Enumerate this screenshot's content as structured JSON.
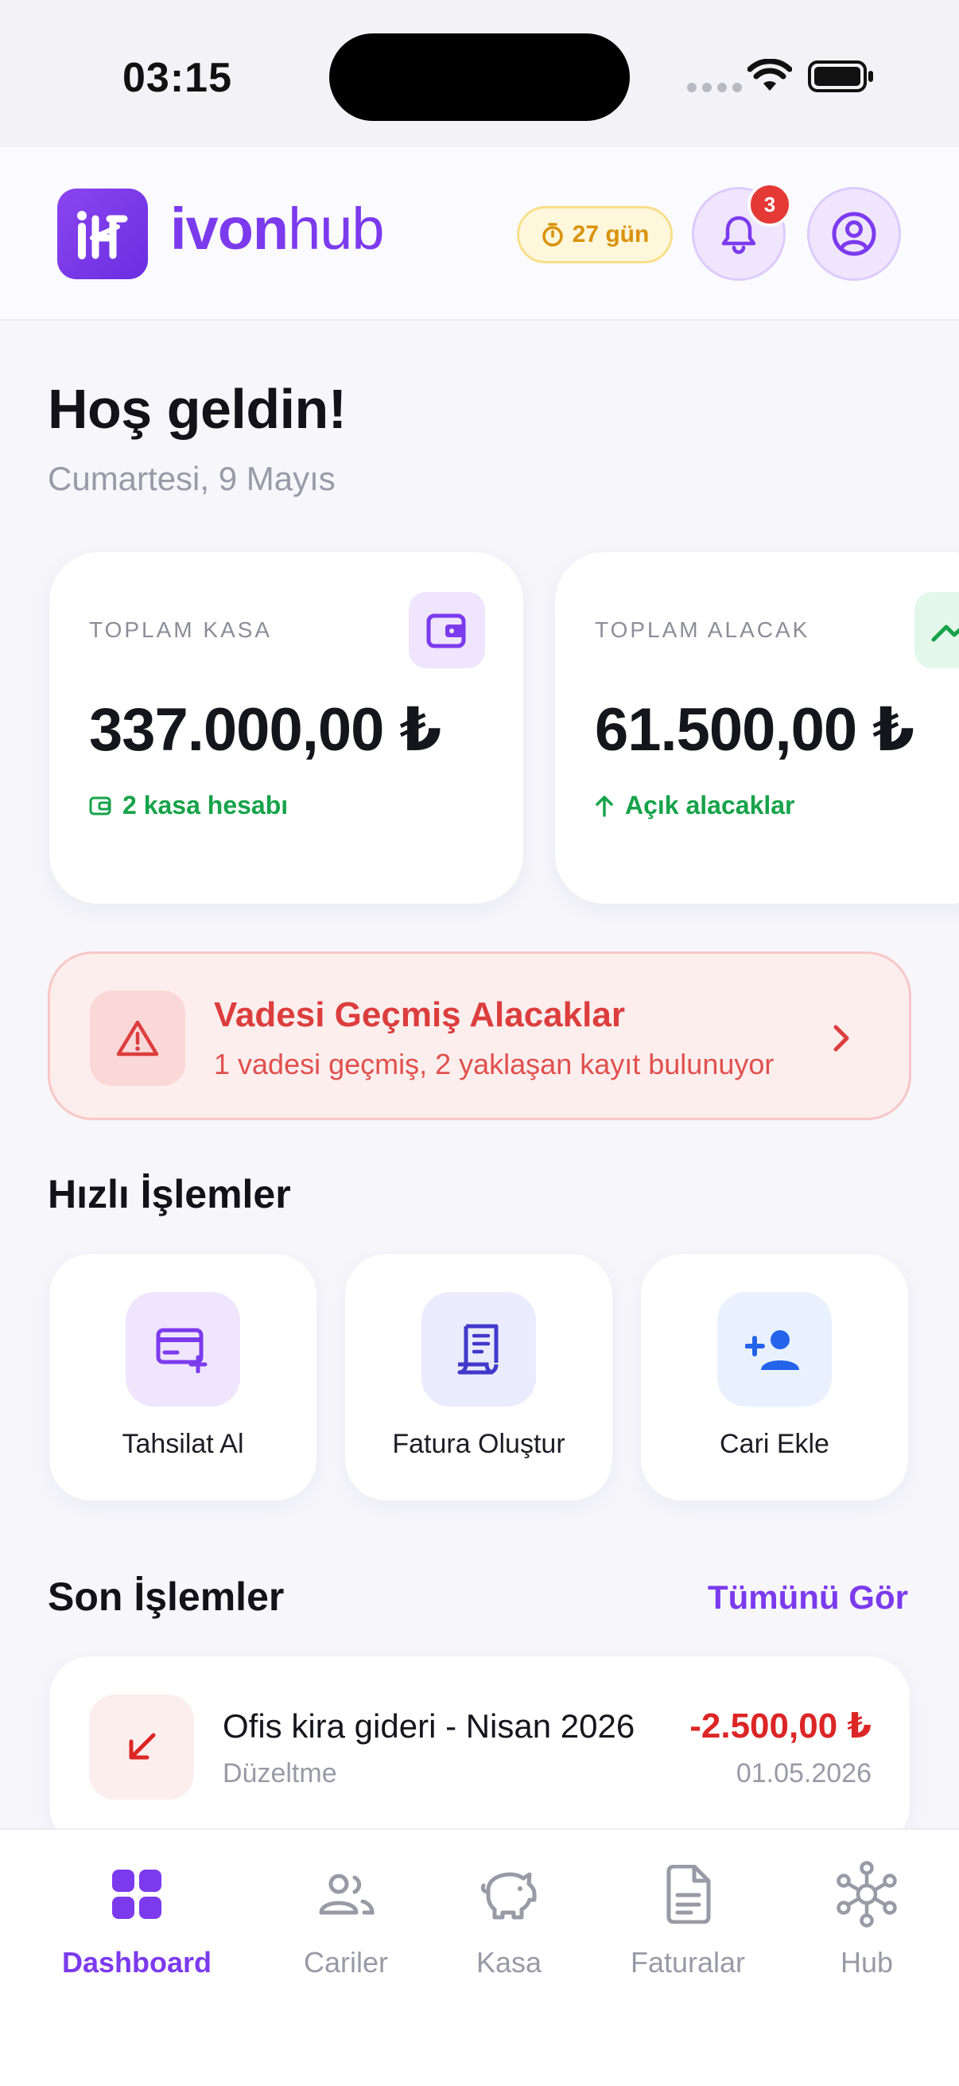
{
  "status_bar": {
    "time": "03:15"
  },
  "header": {
    "brand_bold": "ivon",
    "brand_light": "hub",
    "trial_label": "27 gün",
    "notification_count": "3"
  },
  "greeting": {
    "title": "Hoş geldin!",
    "date": "Cumartesi, 9 Mayıs"
  },
  "stats": [
    {
      "label": "TOPLAM KASA",
      "value": "337.000,00 ₺",
      "sub": "2 kasa hesabı",
      "icon": "wallet-icon"
    },
    {
      "label": "TOPLAM ALACAK",
      "value": "61.500,00 ₺",
      "sub": "Açık alacaklar",
      "icon": "trend-up-icon"
    }
  ],
  "alert": {
    "title": "Vadesi Geçmiş Alacaklar",
    "description": "1 vadesi geçmiş, 2 yaklaşan kayıt bulunuyor"
  },
  "quick_actions": {
    "title": "Hızlı İşlemler",
    "items": [
      {
        "label": "Tahsilat Al",
        "icon": "card-plus-icon"
      },
      {
        "label": "Fatura Oluştur",
        "icon": "receipt-icon"
      },
      {
        "label": "Cari Ekle",
        "icon": "person-add-icon"
      }
    ]
  },
  "recent": {
    "title": "Son İşlemler",
    "see_all": "Tümünü Gör",
    "items": [
      {
        "title": "Ofis kira gideri - Nisan 2026",
        "type": "Düzeltme",
        "amount": "-2.500,00 ₺",
        "date": "01.05.2026"
      }
    ]
  },
  "nav": {
    "items": [
      {
        "label": "Dashboard",
        "active": true
      },
      {
        "label": "Cariler"
      },
      {
        "label": "Kasa"
      },
      {
        "label": "Faturalar"
      },
      {
        "label": "Hub"
      }
    ]
  },
  "colors": {
    "brand": "#7c3aed",
    "positive": "#16a34a",
    "negative": "#dc2626",
    "warning": "#d9920b"
  }
}
